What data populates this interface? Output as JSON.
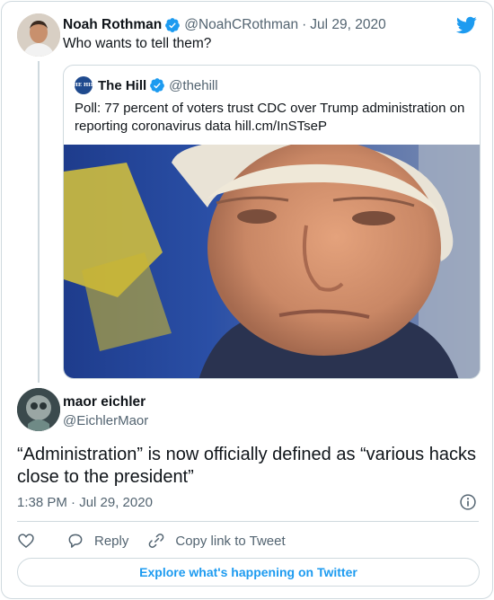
{
  "parent_tweet": {
    "author_name": "Noah Rothman",
    "handle": "@NoahCRothman",
    "separator": "·",
    "date": "Jul 29, 2020",
    "text": "Who wants to tell them?",
    "verified": true
  },
  "quoted_tweet": {
    "author_name": "The Hill",
    "avatar_text": "THE HILL",
    "handle": "@thehill",
    "verified": true,
    "text": "Poll: 77 percent of voters trust CDC over Trump administration on reporting coronavirus data hill.cm/InSTseP"
  },
  "reply_tweet": {
    "author_name": "maor eichler",
    "handle": "@EichlerMaor",
    "text": "“Administration” is now officially defined as “various hacks close to the president”",
    "timestamp": "1:38 PM · Jul 29, 2020"
  },
  "actions": {
    "reply_label": "Reply",
    "copy_link_label": "Copy link to Tweet"
  },
  "explore_label": "Explore what's happening on Twitter",
  "icons": {
    "verified": "verified-badge-icon",
    "brand": "twitter-bird-icon",
    "info": "info-icon",
    "like": "heart-icon",
    "reply": "reply-bubble-icon",
    "copy_link": "link-icon"
  },
  "colors": {
    "accent": "#1d9bf0",
    "text_primary": "#0f1419",
    "text_secondary": "#536471",
    "border": "#cfd9de"
  }
}
